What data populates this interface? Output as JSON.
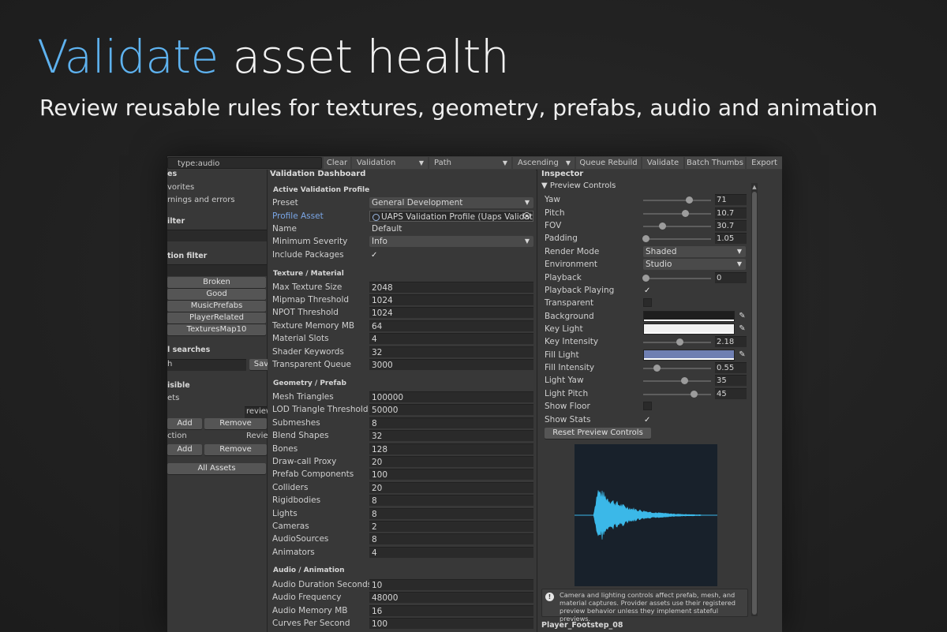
{
  "hero": {
    "title_accent": "Validate",
    "title_rest": "asset health",
    "subtitle": "Review reusable rules for textures, geometry, prefabs, audio and animation"
  },
  "colors": {
    "accent": "#5eb2ef",
    "fill_light": "#6f7fb2",
    "key_light": "#f2f2f2",
    "background": "#1e1e1e",
    "waveform": "#3bb8e8"
  },
  "toolbar": {
    "search_value": "type:audio",
    "clear_label": "Clear",
    "mode_select": "Validation",
    "sort_field": "Path",
    "sort_order": "Ascending",
    "queue_rebuild": "Queue Rebuild",
    "validate": "Validate",
    "batch_thumbs": "Batch Thumbs",
    "export": "Export"
  },
  "left": {
    "queries_header": "es",
    "favorites": "vorites",
    "warnings": "rnings and errors",
    "filter_header": "ilter",
    "collection_filter_header": "tion filter",
    "tags": [
      "Broken",
      "Good",
      "MusicPrefabs",
      "PlayerRelated",
      "TexturesMap10"
    ],
    "searches_header": "l searches",
    "search_field": "h",
    "save_label": "Sav",
    "visible_header": "isible",
    "sets_label": "ets",
    "review_field": "review",
    "add_label": "Add",
    "remove_label": "Remove",
    "collection_label": "ction",
    "review_label": "Revie",
    "all_assets": "All Assets"
  },
  "dashboard": {
    "title": "Validation Dashboard",
    "groups": {
      "profile": "Active Validation Profile",
      "texture": "Texture / Material",
      "geometry": "Geometry / Prefab",
      "audio": "Audio / Animation"
    },
    "profile": {
      "preset_label": "Preset",
      "preset_value": "General Development",
      "profile_asset_label": "Profile Asset",
      "profile_asset_value": "UAPS Validation Profile (Uaps Validatio",
      "name_label": "Name",
      "name_value": "Default",
      "min_severity_label": "Minimum Severity",
      "min_severity_value": "Info",
      "include_packages_label": "Include Packages",
      "include_packages_value": "✓"
    },
    "texture_rows": [
      {
        "label": "Max Texture Size",
        "value": "2048"
      },
      {
        "label": "Mipmap Threshold",
        "value": "1024"
      },
      {
        "label": "NPOT Threshold",
        "value": "1024"
      },
      {
        "label": "Texture Memory MB",
        "value": "64"
      },
      {
        "label": "Material Slots",
        "value": "4"
      },
      {
        "label": "Shader Keywords",
        "value": "32"
      },
      {
        "label": "Transparent Queue",
        "value": "3000"
      }
    ],
    "geometry_rows": [
      {
        "label": "Mesh Triangles",
        "value": "100000"
      },
      {
        "label": "LOD Triangle Threshold",
        "value": "50000"
      },
      {
        "label": "Submeshes",
        "value": "8"
      },
      {
        "label": "Blend Shapes",
        "value": "32"
      },
      {
        "label": "Bones",
        "value": "128"
      },
      {
        "label": "Draw-call Proxy",
        "value": "20"
      },
      {
        "label": "Prefab Components",
        "value": "100"
      },
      {
        "label": "Colliders",
        "value": "20"
      },
      {
        "label": "Rigidbodies",
        "value": "8"
      },
      {
        "label": "Lights",
        "value": "8"
      },
      {
        "label": "Cameras",
        "value": "2"
      },
      {
        "label": "AudioSources",
        "value": "8"
      },
      {
        "label": "Animators",
        "value": "4"
      }
    ],
    "audio_rows": [
      {
        "label": "Audio Duration Seconds",
        "value": "10"
      },
      {
        "label": "Audio Frequency",
        "value": "48000"
      },
      {
        "label": "Audio Memory MB",
        "value": "16"
      },
      {
        "label": "Curves Per Second",
        "value": "100"
      }
    ]
  },
  "inspector": {
    "title": "Inspector",
    "foldout": "Preview Controls",
    "yaw": {
      "label": "Yaw",
      "value": "71",
      "fraction": 0.68
    },
    "pitch": {
      "label": "Pitch",
      "value": "10.7",
      "fraction": 0.62
    },
    "fov": {
      "label": "FOV",
      "value": "30.7",
      "fraction": 0.28
    },
    "padding": {
      "label": "Padding",
      "value": "1.05",
      "fraction": 0.04
    },
    "render_mode": {
      "label": "Render Mode",
      "value": "Shaded"
    },
    "environment": {
      "label": "Environment",
      "value": "Studio"
    },
    "playback": {
      "label": "Playback",
      "value": "0",
      "fraction": 0.04
    },
    "playback_playing": {
      "label": "Playback Playing",
      "value": "✓"
    },
    "transparent": {
      "label": "Transparent"
    },
    "background": {
      "label": "Background"
    },
    "key_light": {
      "label": "Key Light"
    },
    "key_intensity": {
      "label": "Key Intensity",
      "value": "2.18",
      "fraction": 0.54
    },
    "fill_light": {
      "label": "Fill Light"
    },
    "fill_intensity": {
      "label": "Fill Intensity",
      "value": "0.55",
      "fraction": 0.2
    },
    "light_yaw": {
      "label": "Light Yaw",
      "value": "35",
      "fraction": 0.6
    },
    "light_pitch": {
      "label": "Light Pitch",
      "value": "45",
      "fraction": 0.74
    },
    "show_floor": {
      "label": "Show Floor"
    },
    "show_stats": {
      "label": "Show Stats",
      "value": "✓"
    },
    "reset_button": "Reset Preview Controls",
    "info_icon": "!",
    "info_text": "Camera and lighting controls affect prefab, mesh, and material captures. Provider assets use their registered preview behavior unless they implement stateful previews.",
    "asset_name": "Player_Footstep_08"
  }
}
